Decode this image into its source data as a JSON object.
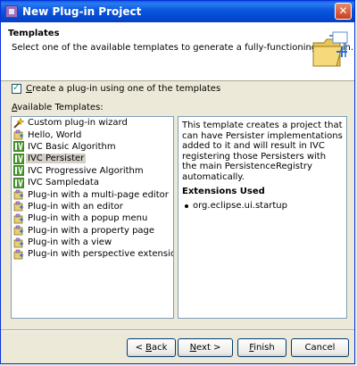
{
  "window": {
    "title": "New Plug-in Project"
  },
  "banner": {
    "title": "Templates",
    "description": "Select one of the available templates to generate a fully-functioning plug-in."
  },
  "options": {
    "use_template_label_mnemonic": "C",
    "use_template_label_rest": "reate a plug-in using one of the templates",
    "use_template_checked": true,
    "available_label_mnemonic": "A",
    "available_label_rest": "vailable Templates:"
  },
  "templates": [
    {
      "label": "Custom plug-in wizard",
      "icon": "wizard-wand-icon"
    },
    {
      "label": "Hello, World",
      "icon": "plugin-template-icon"
    },
    {
      "label": "IVC Basic Algorithm",
      "icon": "ivc-algorithm-icon"
    },
    {
      "label": "IVC Persister",
      "icon": "ivc-algorithm-icon",
      "selected": true
    },
    {
      "label": "IVC Progressive Algorithm",
      "icon": "ivc-algorithm-icon"
    },
    {
      "label": "IVC Sampledata",
      "icon": "ivc-algorithm-icon"
    },
    {
      "label": "Plug-in with a multi-page editor",
      "icon": "plugin-template-icon"
    },
    {
      "label": "Plug-in with an editor",
      "icon": "plugin-template-icon"
    },
    {
      "label": "Plug-in with a popup menu",
      "icon": "plugin-template-icon"
    },
    {
      "label": "Plug-in with a property page",
      "icon": "plugin-template-icon"
    },
    {
      "label": "Plug-in with a view",
      "icon": "plugin-template-icon"
    },
    {
      "label": "Plug-in with perspective extensions",
      "icon": "plugin-template-icon"
    }
  ],
  "description": {
    "text": "This template creates a project that can have Persister implementations added to it and will result in IVC registering those Persisters with the main PersistenceRegistry automatically.",
    "extensions_title": "Extensions Used",
    "extensions": [
      "org.eclipse.ui.startup"
    ]
  },
  "buttons": {
    "back_pre": "< ",
    "back_mn": "B",
    "back_post": "ack",
    "next_mn": "N",
    "next_post": "ext >",
    "finish_mn": "F",
    "finish_post": "inish",
    "cancel": "Cancel"
  }
}
